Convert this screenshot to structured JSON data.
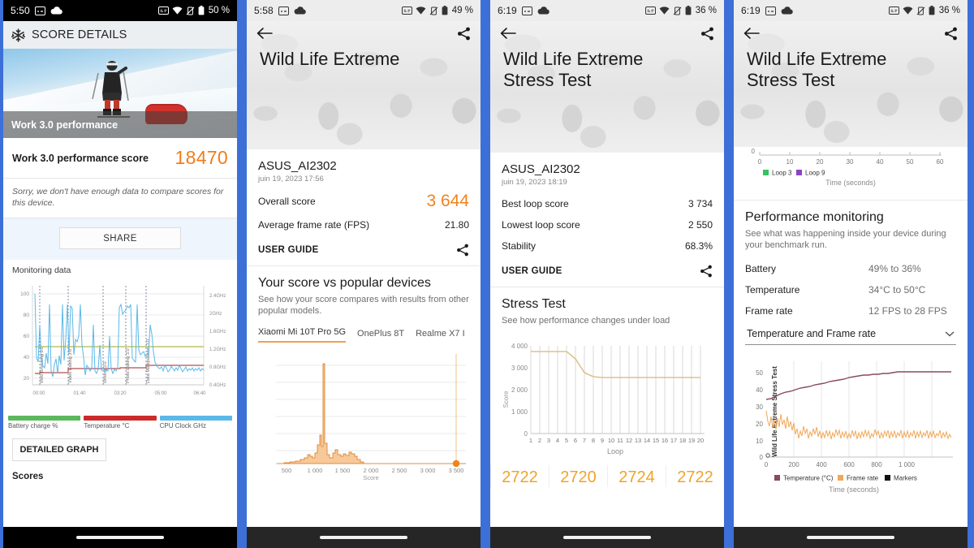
{
  "panels": [
    {
      "status": {
        "time": "5:50",
        "battery": "50 %"
      },
      "appbar": {
        "title": "SCORE DETAILS",
        "icon": "snowflake-icon"
      },
      "hero": {
        "caption": "Work 3.0 performance"
      },
      "score": {
        "label": "Work 3.0 performance score",
        "value": "18470",
        "color": "#f07d1a"
      },
      "note": "Sorry, we don't have enough data to compare scores for this device.",
      "share_button": "SHARE",
      "monitoring_label": "Monitoring data",
      "detailed_graph_button": "DETAILED GRAPH",
      "scores_label": "Scores",
      "legend": [
        {
          "label": "Battery charge %",
          "color": "#5cb85c"
        },
        {
          "label": "Temperature °C",
          "color": "#cc2b2b"
        },
        {
          "label": "CPU Clock GHz",
          "color": "#5bb8e8"
        }
      ]
    },
    {
      "status": {
        "time": "5:58",
        "battery": "49 %"
      },
      "header_title": "Wild Life Extreme",
      "device": "ASUS_AI2302",
      "date": "juin 19, 2023 17:56",
      "rows": [
        {
          "label": "Overall score",
          "value": "3 644",
          "big": true
        },
        {
          "label": "Average frame rate (FPS)",
          "value": "21.80",
          "big": false
        }
      ],
      "user_guide": "USER GUIDE",
      "section_title": "Your score vs popular devices",
      "section_sub": "See how your score compares with results from other popular models.",
      "tabs": [
        {
          "label": "Xiaomi Mi 10T Pro 5G",
          "active": true
        },
        {
          "label": "OnePlus 8T",
          "active": false
        },
        {
          "label": "Realme X7 I",
          "active": false
        }
      ]
    },
    {
      "status": {
        "time": "6:19",
        "battery": "36 %"
      },
      "header_title": "Wild Life Extreme\nStress Test",
      "device": "ASUS_AI2302",
      "date": "juin 19, 2023 18:19",
      "rows": [
        {
          "label": "Best loop score",
          "value": "3 734"
        },
        {
          "label": "Lowest loop score",
          "value": "2 550"
        },
        {
          "label": "Stability",
          "value": "68.3%"
        }
      ],
      "user_guide": "USER GUIDE",
      "section_title": "Stress Test",
      "section_sub": "See how performance changes under load",
      "bignums": [
        "2722",
        "2720",
        "2724",
        "2722"
      ]
    },
    {
      "status": {
        "time": "6:19",
        "battery": "36 %"
      },
      "header_title": "Wild Life Extreme\nStress Test",
      "section_title": "Performance monitoring",
      "section_sub": "See what was happening inside your device during your benchmark run.",
      "rows": [
        {
          "label": "Battery",
          "value": "49% to 36%"
        },
        {
          "label": "Temperature",
          "value": "34°C to 50°C"
        },
        {
          "label": "Frame rate",
          "value": "12 FPS to 28 FPS"
        }
      ],
      "dropdown": "Temperature and Frame rate"
    }
  ],
  "chart_data": [
    {
      "type": "line",
      "title": "Monitoring data",
      "xlabel": "",
      "ylabel": "",
      "xticks": [
        "00:00",
        "01:40",
        "03:20",
        "05:00",
        "06:40"
      ],
      "yticks_left": [
        "20",
        "40",
        "60",
        "80",
        "100"
      ],
      "ylim": [
        10,
        105
      ],
      "yticks_right": [
        "0.4GHz",
        "0.8GHz",
        "1.2GHz",
        "1.6GHz",
        "2GHz",
        "2.4GHz"
      ],
      "grid": true,
      "markers": [
        "Web Browsing 3.0",
        "Video Editing 3.0",
        "Writing 3.0",
        "Photo Editing 3.0",
        "Data Manipulation 3.0"
      ],
      "marker_x": [
        0.04,
        0.21,
        0.41,
        0.54,
        0.66
      ],
      "series": [
        {
          "name": "Battery charge %",
          "color": "#b5b84a",
          "values": [
            50,
            50,
            50,
            50,
            50,
            50,
            50,
            50,
            50,
            50,
            50,
            50,
            50,
            50,
            50,
            50,
            50,
            50,
            50,
            50,
            50,
            50,
            50,
            50,
            50,
            50,
            50,
            50,
            50,
            50,
            50,
            50,
            50,
            50,
            50,
            50,
            50,
            50,
            50,
            50
          ]
        },
        {
          "name": "Temperature °C",
          "color": "#b05050",
          "values": [
            28,
            29,
            29,
            29,
            29,
            29,
            29,
            29,
            29,
            30,
            31,
            31,
            31,
            31,
            31,
            31,
            31,
            31,
            31,
            31,
            31,
            31,
            31,
            31,
            31,
            31,
            31,
            32,
            32,
            32,
            32,
            32,
            32,
            32,
            32,
            32,
            32,
            32,
            32,
            32
          ]
        },
        {
          "name": "CPU Clock GHz",
          "color": "#5bb8e8",
          "values": [
            100,
            42,
            38,
            75,
            41,
            35,
            33,
            48,
            36,
            90,
            30,
            25,
            34,
            40,
            28,
            44,
            33,
            90,
            38,
            60,
            90,
            47,
            88,
            85,
            46,
            60,
            58,
            63,
            90,
            55,
            44,
            27,
            35,
            33,
            30,
            32,
            75,
            30,
            28,
            32,
            55,
            31,
            33,
            29,
            31,
            30,
            50,
            32,
            28,
            31,
            30,
            33,
            84,
            90,
            78,
            80,
            82,
            88,
            86,
            90,
            42,
            40,
            38,
            90,
            52,
            46,
            48,
            50,
            44,
            46,
            47,
            75,
            66,
            50,
            38,
            35,
            33,
            32,
            34,
            30
          ]
        }
      ]
    },
    {
      "type": "histogram",
      "title": "Your score vs popular devices",
      "xlabel": "Score",
      "xticks": [
        500,
        1000,
        1500,
        2000,
        2500,
        3000,
        3500
      ],
      "xlim": [
        380,
        3780
      ],
      "ylim": [
        0,
        100
      ],
      "grid": true,
      "marker_value": 3644,
      "marker_color": "#f2821c",
      "bin_width": 50,
      "bins": [
        {
          "x": 500,
          "y": 0
        },
        {
          "x": 550,
          "y": 1
        },
        {
          "x": 600,
          "y": 2
        },
        {
          "x": 650,
          "y": 3
        },
        {
          "x": 700,
          "y": 4
        },
        {
          "x": 750,
          "y": 6
        },
        {
          "x": 800,
          "y": 9
        },
        {
          "x": 850,
          "y": 8
        },
        {
          "x": 900,
          "y": 7
        },
        {
          "x": 950,
          "y": 14
        },
        {
          "x": 1000,
          "y": 26
        },
        {
          "x": 1050,
          "y": 96
        },
        {
          "x": 1100,
          "y": 22
        },
        {
          "x": 1150,
          "y": 10
        },
        {
          "x": 1200,
          "y": 7
        },
        {
          "x": 1250,
          "y": 12
        },
        {
          "x": 1300,
          "y": 10
        },
        {
          "x": 1350,
          "y": 7
        },
        {
          "x": 1400,
          "y": 8
        },
        {
          "x": 1450,
          "y": 11
        },
        {
          "x": 1500,
          "y": 10
        },
        {
          "x": 1550,
          "y": 6
        },
        {
          "x": 1600,
          "y": 3
        },
        {
          "x": 1650,
          "y": 1
        },
        {
          "x": 1700,
          "y": 0
        }
      ]
    },
    {
      "type": "line",
      "title": "Stress Test",
      "xlabel": "Loop",
      "ylabel": "Score",
      "xticks": [
        1,
        2,
        3,
        4,
        5,
        6,
        7,
        8,
        9,
        10,
        11,
        12,
        13,
        14,
        15,
        16,
        17,
        18,
        19,
        20
      ],
      "yticks": [
        "0",
        "1 000",
        "2 000",
        "3 000",
        "4 000"
      ],
      "ylim": [
        0,
        4000
      ],
      "grid": true,
      "color": "#e0c08a",
      "values": [
        3734,
        3732,
        3730,
        3728,
        3726,
        3400,
        2800,
        2600,
        2556,
        2552,
        2550,
        2552,
        2554,
        2552,
        2550,
        2552,
        2553,
        2551,
        2550,
        2552
      ]
    },
    {
      "type": "line",
      "title": "",
      "xlabel": "Time (seconds)",
      "xticks": [
        0,
        10,
        20,
        30,
        40,
        50,
        60
      ],
      "xlim": [
        0,
        62
      ],
      "yticks": [
        "0"
      ],
      "legend": [
        {
          "label": "Loop 3",
          "color": "#35c45f"
        },
        {
          "label": "Loop 9",
          "color": "#8a44c4"
        }
      ],
      "legend_position": "bottom-left"
    },
    {
      "type": "line",
      "title": "",
      "xlabel": "Time (seconds)",
      "ylabel": "Wild Life Extreme Stress Test",
      "xticks": [
        0,
        200,
        400,
        600,
        800,
        "1 000"
      ],
      "xlim": [
        0,
        1200
      ],
      "yticks": [
        "0",
        "10",
        "20",
        "30",
        "40",
        "50"
      ],
      "ylim": [
        0,
        56
      ],
      "grid": true,
      "legend": [
        {
          "label": "Temperature (°C)",
          "color": "#8a4a60"
        },
        {
          "label": "Frame rate",
          "color": "#f0a85a"
        },
        {
          "label": "Markers",
          "color": "#111111"
        }
      ],
      "series": [
        {
          "name": "Temperature (°C)",
          "color": "#8a4a60",
          "values": [
            34,
            35,
            37,
            38,
            39,
            39,
            40,
            41,
            41,
            42,
            43,
            43,
            44,
            45,
            45,
            45,
            45,
            46,
            46,
            47,
            47,
            47,
            47,
            47,
            48,
            48,
            49,
            50,
            50,
            50,
            50,
            50,
            50,
            50,
            50,
            50
          ]
        },
        {
          "name": "Frame rate",
          "color": "#f0a85a",
          "values": [
            27,
            22,
            19,
            25,
            18,
            23,
            17,
            24,
            19,
            26,
            20,
            23,
            18,
            25,
            19,
            22,
            17,
            21,
            14,
            17,
            12,
            16,
            13,
            18,
            14,
            17,
            12,
            16,
            13,
            17,
            14,
            18,
            13,
            16,
            12,
            15
          ]
        }
      ]
    }
  ]
}
